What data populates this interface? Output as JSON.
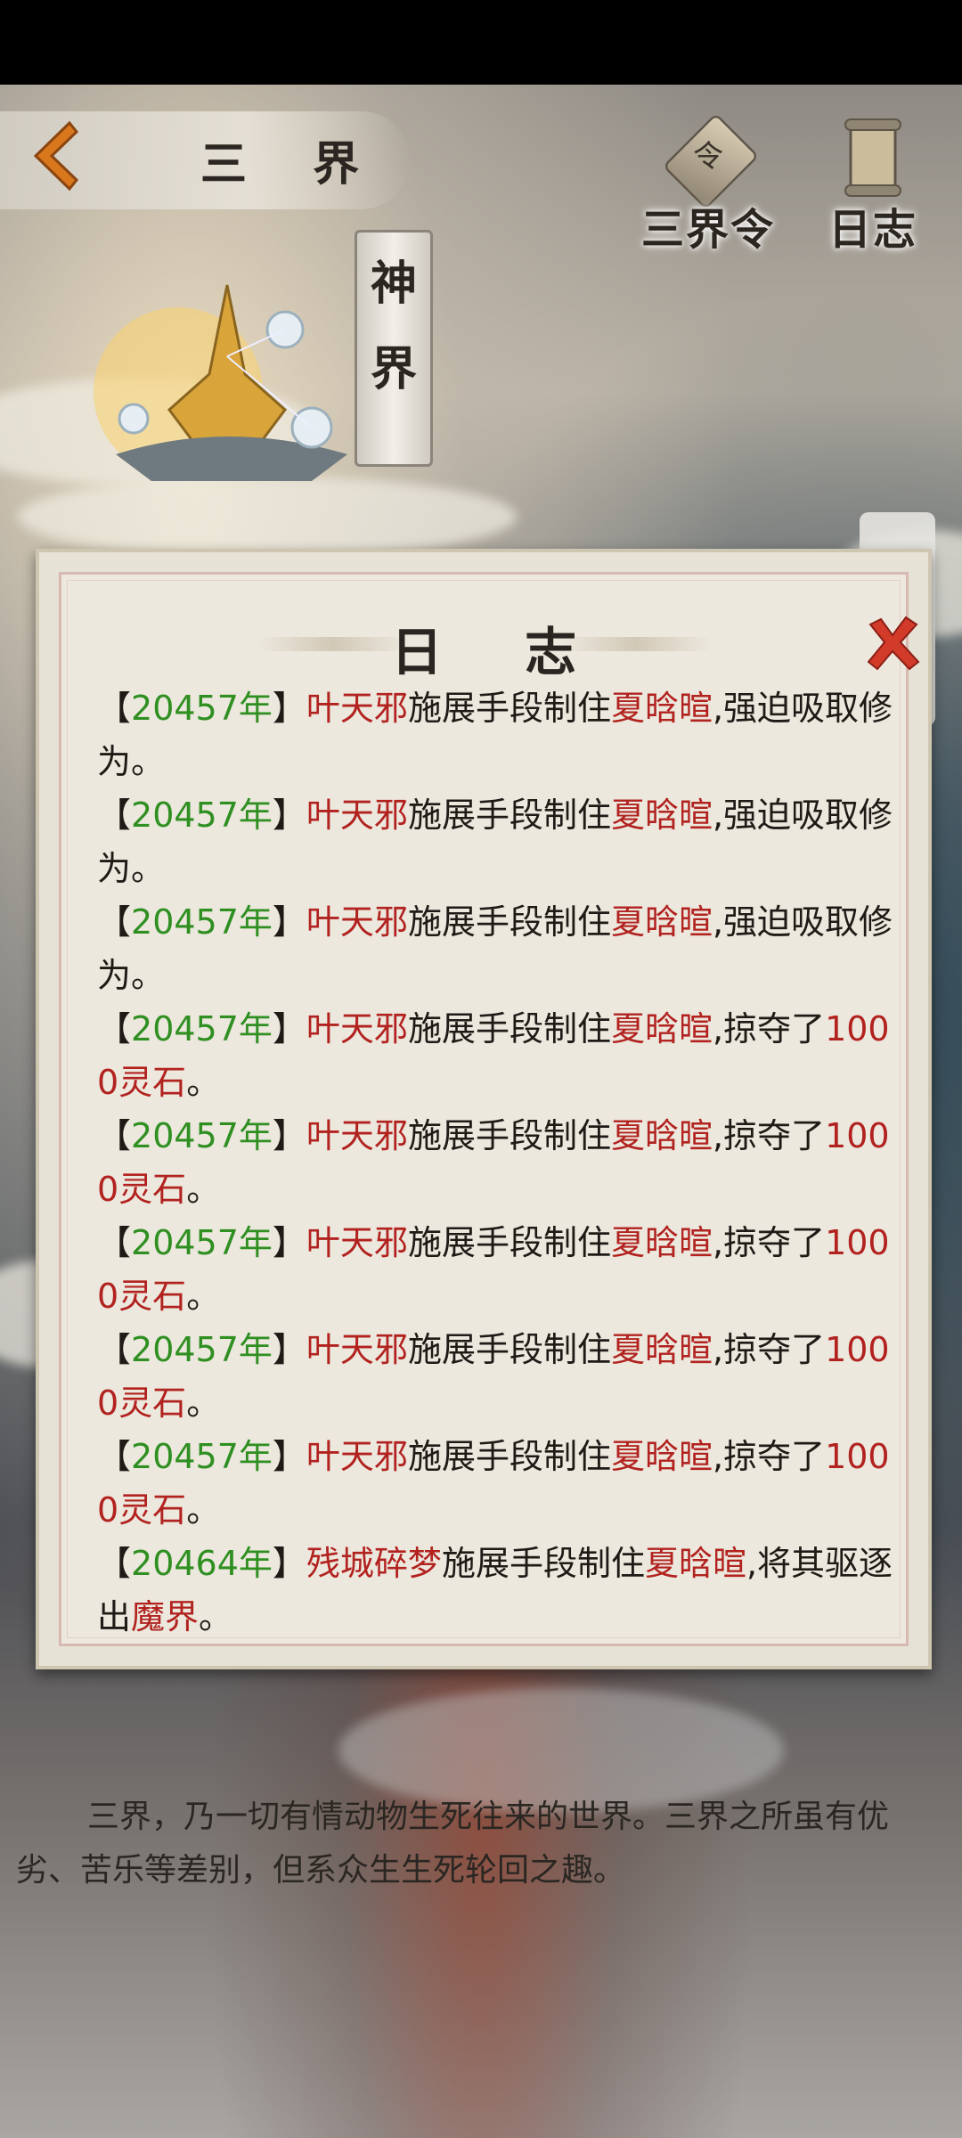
{
  "header": {
    "title": "三 界",
    "buttons": [
      {
        "id": "ling",
        "label": "三界令",
        "emblem": "令"
      },
      {
        "id": "log",
        "label": "日志",
        "emblem": ""
      }
    ]
  },
  "realm_tag": {
    "line1": "神",
    "line2": "界"
  },
  "dialog": {
    "title": "日 志",
    "entries": [
      {
        "open": "【",
        "year": "20457年",
        "close": "】",
        "actor": "叶天邪",
        "verb": "施展手段制住",
        "target": "夏晗暄",
        "rest": ",强迫吸取修为。",
        "amount": "",
        "tail": ""
      },
      {
        "open": "【",
        "year": "20457年",
        "close": "】",
        "actor": "叶天邪",
        "verb": "施展手段制住",
        "target": "夏晗暄",
        "rest": ",强迫吸取修为。",
        "amount": "",
        "tail": ""
      },
      {
        "open": "【",
        "year": "20457年",
        "close": "】",
        "actor": "叶天邪",
        "verb": "施展手段制住",
        "target": "夏晗暄",
        "rest": ",强迫吸取修为。",
        "amount": "",
        "tail": ""
      },
      {
        "open": "【",
        "year": "20457年",
        "close": "】",
        "actor": "叶天邪",
        "verb": "施展手段制住",
        "target": "夏晗暄",
        "rest": ",掠夺了",
        "amount": "1000灵石",
        "tail": "。"
      },
      {
        "open": "【",
        "year": "20457年",
        "close": "】",
        "actor": "叶天邪",
        "verb": "施展手段制住",
        "target": "夏晗暄",
        "rest": ",掠夺了",
        "amount": "1000灵石",
        "tail": "。"
      },
      {
        "open": "【",
        "year": "20457年",
        "close": "】",
        "actor": "叶天邪",
        "verb": "施展手段制住",
        "target": "夏晗暄",
        "rest": ",掠夺了",
        "amount": "1000灵石",
        "tail": "。"
      },
      {
        "open": "【",
        "year": "20457年",
        "close": "】",
        "actor": "叶天邪",
        "verb": "施展手段制住",
        "target": "夏晗暄",
        "rest": ",掠夺了",
        "amount": "1000灵石",
        "tail": "。"
      },
      {
        "open": "【",
        "year": "20457年",
        "close": "】",
        "actor": "叶天邪",
        "verb": "施展手段制住",
        "target": "夏晗暄",
        "rest": ",掠夺了",
        "amount": "1000灵石",
        "tail": "。"
      },
      {
        "open": "【",
        "year": "20464年",
        "close": "】",
        "actor": "残城碎梦",
        "verb": "施展手段制住",
        "target": "夏晗暄",
        "rest": ",将其驱逐出",
        "amount": "魔界",
        "tail": "。"
      }
    ]
  },
  "description": "三界，乃一切有情动物生死往来的世界。三界之所虽有优劣、苦乐等差别，但系众生生死轮回之趣。",
  "colors": {
    "year": "#2f8f21",
    "highlight": "#b2221f",
    "panel": "#ece8de"
  },
  "icons": [
    "back-arrow-icon",
    "close-icon",
    "scroll-icon",
    "token-icon"
  ]
}
